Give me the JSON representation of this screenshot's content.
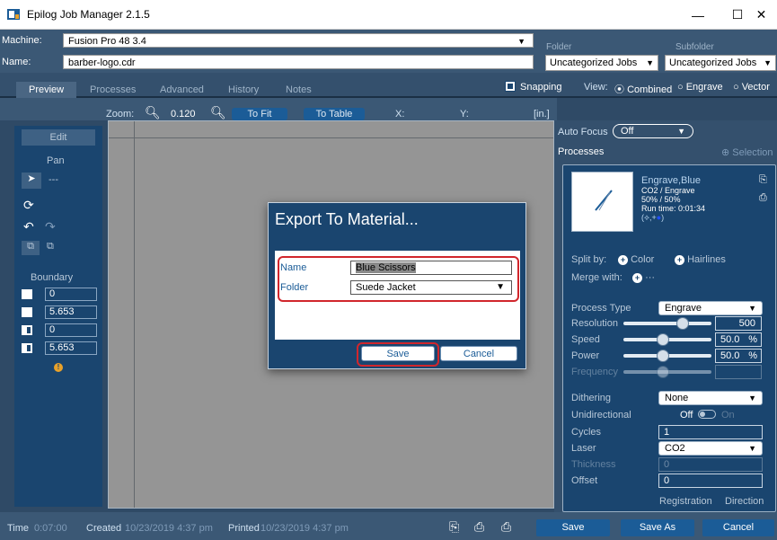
{
  "window": {
    "title": "Epilog Job Manager 2.1.5",
    "minimize": "—",
    "maximize": "☐",
    "close": "✕"
  },
  "header": {
    "machine_label": "Machine:",
    "machine_value": "Fusion Pro 48 3.4",
    "name_label": "Name:",
    "name_value": "barber-logo.cdr",
    "folder_label": "Folder",
    "folder_value": "Uncategorized Jobs",
    "subfolder_label": "Subfolder",
    "subfolder_value": "Uncategorized Jobs"
  },
  "tabs": [
    "Preview",
    "Processes",
    "Advanced",
    "History",
    "Notes"
  ],
  "view": {
    "snapping_label": "Snapping",
    "view_label": "View:",
    "options": [
      "Combined",
      "Engrave",
      "Vector"
    ],
    "selected": "Combined"
  },
  "zoom": {
    "label": "Zoom:",
    "value": "0.120",
    "to_fit": "To Fit",
    "to_table": "To Table",
    "x_label": "X:",
    "y_label": "Y:",
    "unit": "[in.]"
  },
  "left_panel": {
    "edit": "Edit",
    "pan": "Pan",
    "pointer_text": "---",
    "boundary_label": "Boundary",
    "boundary_values": [
      "0",
      "5.653",
      "0",
      "5.653"
    ]
  },
  "right_panel": {
    "auto_focus_label": "Auto Focus",
    "auto_focus_value": "Off",
    "processes_label": "Processes",
    "selection_label": "Selection",
    "process_title": "Engrave,Blue",
    "process_type_line": "CO2 / Engrave",
    "process_speed_power": "50% / 50%",
    "process_runtime": "Run time: 0:01:34",
    "split_by_label": "Split by:",
    "split_color": "Color",
    "split_hairlines": "Hairlines",
    "merge_with_label": "Merge with:",
    "merge_dots": "···",
    "process_type_label": "Process Type",
    "process_type_value": "Engrave",
    "resolution_label": "Resolution",
    "resolution_value": "500",
    "speed_label": "Speed",
    "speed_value": "50.0",
    "speed_unit": "%",
    "power_label": "Power",
    "power_value": "50.0",
    "power_unit": "%",
    "frequency_label": "Frequency",
    "dithering_label": "Dithering",
    "dithering_value": "None",
    "unidirectional_label": "Unidirectional",
    "unidirectional_off": "Off",
    "unidirectional_on": "On",
    "cycles_label": "Cycles",
    "cycles_value": "1",
    "laser_label": "Laser",
    "laser_value": "CO2",
    "thickness_label": "Thickness",
    "thickness_value": "0",
    "offset_label": "Offset",
    "offset_value": "0",
    "registration_label": "Registration",
    "direction_label": "Direction"
  },
  "bottom": {
    "time_label": "Time",
    "time_value": "0:07:00",
    "created_label": "Created",
    "created_value": "10/23/2019 4:37 pm",
    "printed_label": "Printed",
    "printed_value": "10/23/2019 4:37 pm",
    "save": "Save",
    "save_as": "Save As",
    "cancel": "Cancel"
  },
  "dialog": {
    "title": "Export To Material...",
    "name_label": "Name",
    "name_value": "Blue Scissors",
    "folder_label": "Folder",
    "folder_value": "Suede Jacket",
    "save": "Save",
    "cancel": "Cancel"
  },
  "colors": {
    "accent": "#1b5c97",
    "panel": "#1a456f",
    "highlight": "#d1262c"
  }
}
